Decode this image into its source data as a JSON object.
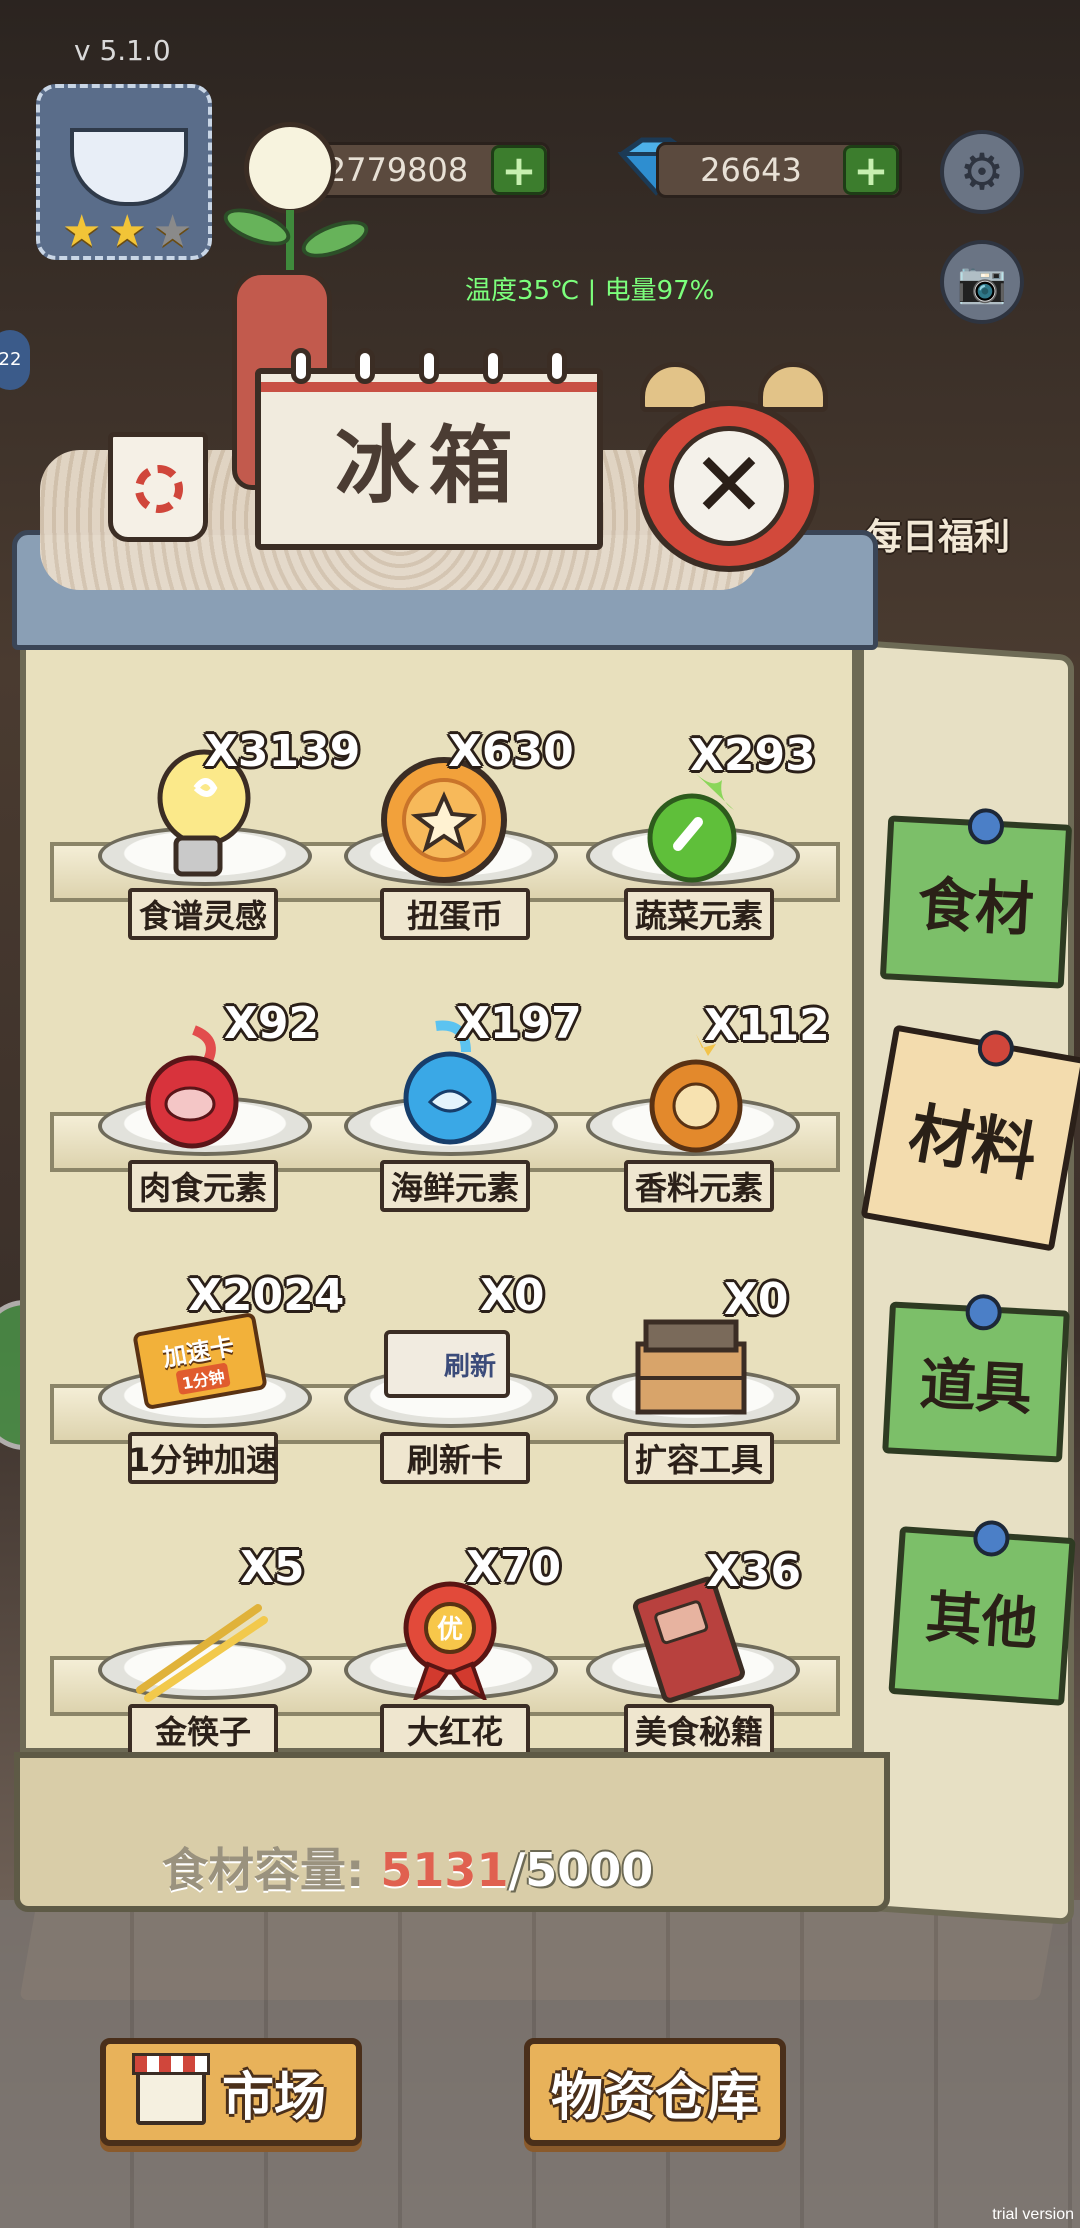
{
  "header": {
    "version": "v 5.1.0",
    "coins": "2779808",
    "gems": "26643",
    "status": "温度35℃ | 电量97%",
    "daily_welfare": "每日福利",
    "side_badge": "22"
  },
  "fridge": {
    "title": "冰箱",
    "capacity_label": "食材容量:",
    "capacity_used": "5131",
    "capacity_total": "/5000"
  },
  "tabs": [
    {
      "label": "食材",
      "active": false
    },
    {
      "label": "材料",
      "active": true
    },
    {
      "label": "道具",
      "active": false
    },
    {
      "label": "其他",
      "active": false
    }
  ],
  "items": [
    {
      "name": "食谱灵感",
      "count": "X3139",
      "icon": "lightbulb-icon"
    },
    {
      "name": "扭蛋币",
      "count": "X630",
      "icon": "gacha-coin-icon"
    },
    {
      "name": "蔬菜元素",
      "count": "X293",
      "icon": "vegetable-element-icon"
    },
    {
      "name": "肉食元素",
      "count": "X92",
      "icon": "meat-element-icon"
    },
    {
      "name": "海鲜元素",
      "count": "X197",
      "icon": "seafood-element-icon"
    },
    {
      "name": "香料元素",
      "count": "X112",
      "icon": "spice-element-icon"
    },
    {
      "name": "1分钟加速",
      "count": "X2024",
      "icon": "speedup-card-icon",
      "card_text": "加速卡",
      "card_sub": "1分钟"
    },
    {
      "name": "刷新卡",
      "count": "X0",
      "icon": "refresh-card-icon",
      "card_text": "刷新"
    },
    {
      "name": "扩容工具",
      "count": "X0",
      "icon": "toolbox-icon"
    },
    {
      "name": "金筷子",
      "count": "X5",
      "icon": "golden-chopsticks-icon"
    },
    {
      "name": "大红花",
      "count": "X70",
      "icon": "red-flower-icon",
      "badge_text": "优"
    },
    {
      "name": "美食秘籍",
      "count": "X36",
      "icon": "recipe-book-icon"
    }
  ],
  "bottom": {
    "market_label": "市场",
    "warehouse_label": "物资仓库"
  },
  "watermark": "trial version",
  "colors": {
    "tab_green": "#7cbf69",
    "tab_active": "#f3dcae",
    "capacity_over": "#e06150",
    "button_orange": "#e8b25a"
  }
}
